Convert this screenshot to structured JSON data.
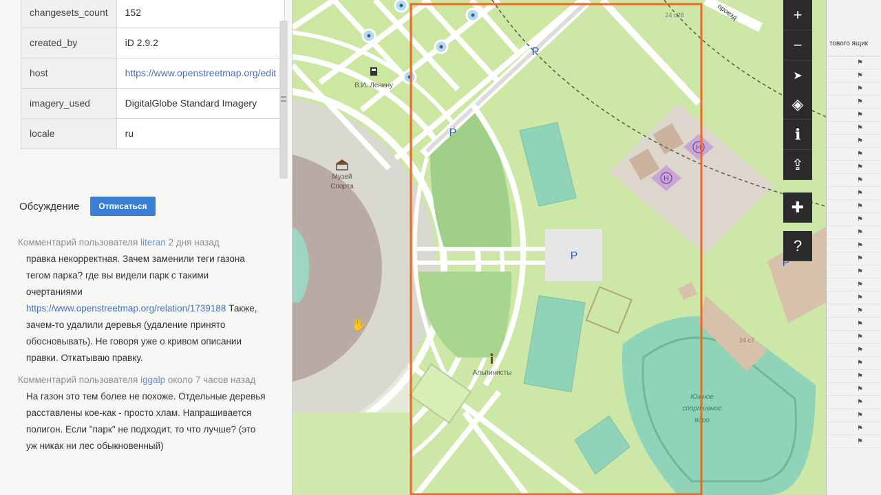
{
  "tags": [
    {
      "key": "changesets_count",
      "value": "152",
      "link": false
    },
    {
      "key": "created_by",
      "value": "iD 2.9.2",
      "link": false
    },
    {
      "key": "host",
      "value": "https://www.openstreetmap.org/edit",
      "link": true
    },
    {
      "key": "imagery_used",
      "value": "DigitalGlobe Standard Imagery",
      "link": false
    },
    {
      "key": "locale",
      "value": "ru",
      "link": false
    }
  ],
  "discussion": {
    "title": "Обсуждение",
    "unsubscribe_label": "Отписаться",
    "comments": [
      {
        "meta_prefix": "Комментарий пользователя",
        "user": "literan",
        "time": "2 дня назад",
        "text_before": "правка некорректная. Зачем заменили теги газона тегом парка? где вы видели парк с такими очертаниями",
        "link": "https://www.openstreetmap.org/relation/1739188",
        "text_after": "Также, зачем-то удалили деревья (удаление принято обосновывать). Не говоря уже о кривом описании правки. Откатываю правку."
      },
      {
        "meta_prefix": "Комментарий пользователя",
        "user": "iggalp",
        "time": "около 7 часов назад",
        "text_before": "На газон это тем более не похоже. Отдельные деревья расставлены кое-как - просто хлам. Напрашивается полигон. Если \"парк\" не подходит, то что лучше? (это уж никак ни лес обыкновенный)",
        "link": "",
        "text_after": ""
      }
    ]
  },
  "map": {
    "labels": {
      "lenin": "В.И. Ленину",
      "museum_1": "Музей",
      "museum_2": "Спорта",
      "alpinists": "Альпинисты",
      "stadium_1": "Южное",
      "stadium_2": "спортивное",
      "stadium_3": "ядро",
      "house_1": "24 с28",
      "house_2": "24 с7",
      "road": "проезд",
      "parking": "P",
      "helipad": "H"
    },
    "colors": {
      "bbox": "#f26522",
      "park": "#c8e6a0",
      "grass": "#cfeca8",
      "pitch": "#88cfb4",
      "forest": "#a8d08c",
      "road": "#ffffff",
      "parking_area": "#e6e6e6",
      "building": "#d8c7b5"
    }
  },
  "controls": [
    {
      "name": "zoom-in",
      "glyph": "+"
    },
    {
      "name": "zoom-out",
      "glyph": "−"
    },
    {
      "name": "geolocate",
      "glyph": "➤"
    },
    {
      "name": "layers",
      "glyph": "◈"
    },
    {
      "name": "info",
      "glyph": "ℹ"
    },
    {
      "name": "share",
      "glyph": "⇪"
    },
    {
      "name": "add-note",
      "glyph": "✚"
    },
    {
      "name": "query",
      "glyph": "?"
    }
  ],
  "right_panel": {
    "header": "тового ящик"
  }
}
